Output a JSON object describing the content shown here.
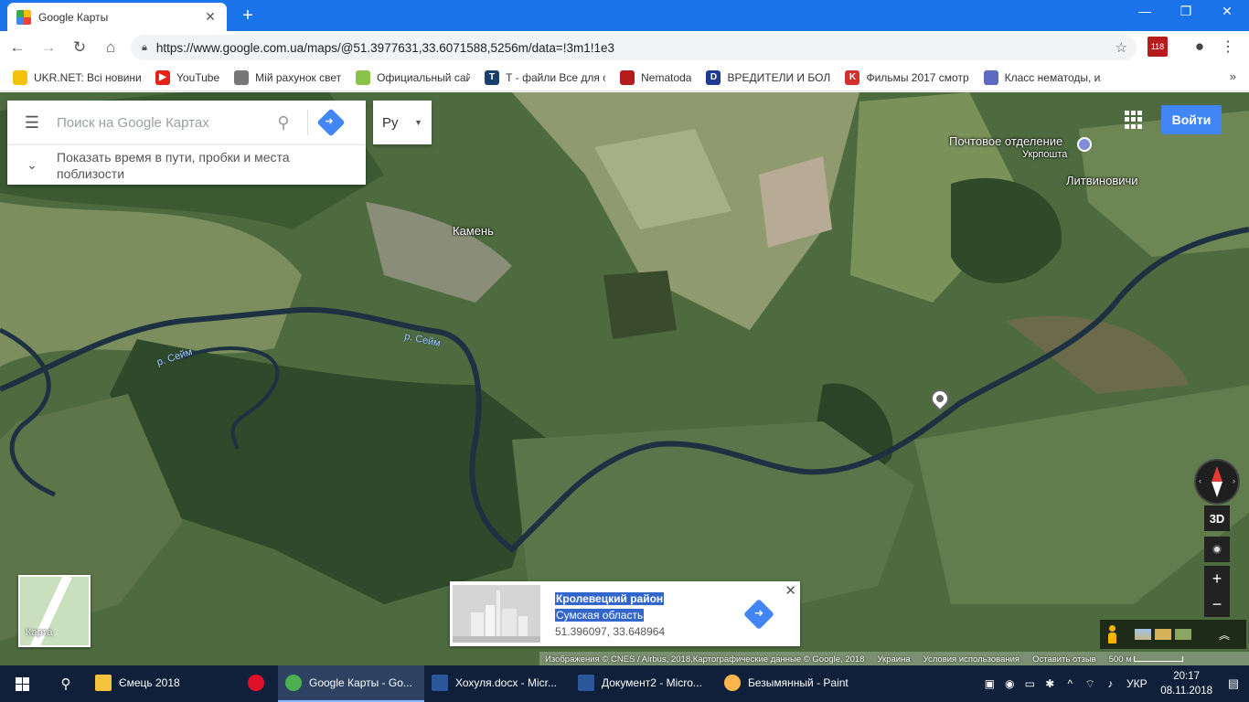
{
  "browser": {
    "tab_title": "Google Карты",
    "url": "https://www.google.com.ua/maps/@51.3977631,33.6071588,5256m/data=!3m1!1e3",
    "ext_badge": "118"
  },
  "bookmarks": [
    {
      "label": "UKR.NET: Всі новини",
      "color": "#f4c20d"
    },
    {
      "label": "YouTube",
      "color": "#e62117"
    },
    {
      "label": "Мій рахунок свет",
      "color": "#777777"
    },
    {
      "label": "Официальный сайт (",
      "color": "#8bc34a"
    },
    {
      "label": "Т - файли Все для ст",
      "color": "#1a3f6b"
    },
    {
      "label": "Nematoda",
      "color": "#b71c1c"
    },
    {
      "label": "ВРЕДИТЕЛИ И БОЛЕ",
      "color": "#1f3a93"
    },
    {
      "label": "Фильмы 2017 смотр",
      "color": "#d32f2f"
    },
    {
      "label": "Класс нематоды, ил",
      "color": "#5c6bc0"
    }
  ],
  "maps": {
    "search_placeholder": "Поиск на Google Картах",
    "expand_text": "Показать время в пути, пробки и места поблизости",
    "lang": "Ру",
    "signin": "Войти",
    "labels": {
      "post_office": "Почтовое отделение",
      "ukrposhta": "Укрпошта",
      "litvinovichi": "Литвиновичи",
      "kamen": "Камень",
      "river1": "р. Сейм",
      "river2": "р. Сейм"
    },
    "btn_3d": "3D",
    "zoom_in": "+",
    "zoom_out": "−",
    "minimap_label": "Карта",
    "card": {
      "name": "Кролевецкий район",
      "region": "Сумская область",
      "coords": "51.396097, 33.648964"
    },
    "attribution": {
      "imagery": "Изображения © CNES / Airbus, 2018,Картографические данные © Google, 2018",
      "country": "Украина",
      "terms": "Условия использования",
      "feedback": "Оставить отзыв",
      "scale": "500 м"
    }
  },
  "taskbar": {
    "items": [
      {
        "label": "Ємець 2018",
        "color": "#f5c33b"
      },
      {
        "label": "",
        "color": "#e0102a"
      },
      {
        "label": "Google Карты - Go...",
        "color": "#4caf50"
      },
      {
        "label": "Хохуля.docx - Micr...",
        "color": "#2b579a"
      },
      {
        "label": "Документ2 - Micro...",
        "color": "#2b579a"
      },
      {
        "label": "Безымянный - Paint",
        "color": "#ffb74d"
      }
    ],
    "lang": "УКР",
    "time": "20:17",
    "date": "08.11.2018"
  }
}
